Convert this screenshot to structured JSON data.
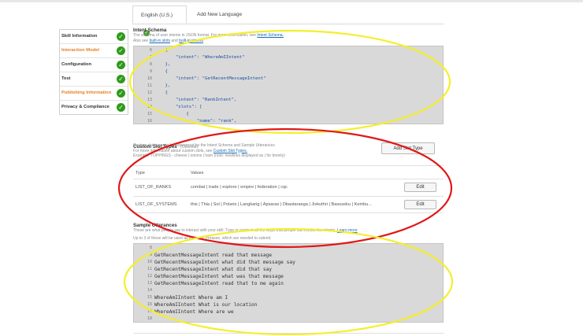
{
  "tabs": [
    {
      "label": "English (U.S.)",
      "active": true
    },
    {
      "label": "Add New Language",
      "active": false
    }
  ],
  "nav": [
    {
      "label": "Skill Information",
      "color": "#333333",
      "complete": true
    },
    {
      "label": "Interaction Model",
      "color": "#e67e22",
      "complete": true
    },
    {
      "label": "Configuration",
      "color": "#333333",
      "complete": true
    },
    {
      "label": "Test",
      "color": "#333333",
      "complete": true
    },
    {
      "label": "Publishing Information",
      "color": "#e67e22",
      "complete": true
    },
    {
      "label": "Privacy & Compliance",
      "color": "#333333",
      "complete": true
    }
  ],
  "intent_schema": {
    "title": "Intent Schema",
    "desc1_pre": "The schema of user intents in JSON format. For more information, see ",
    "desc1_link": "Intent Schema.",
    "desc2_pre": "Also see ",
    "desc2_link1": "built-in slots",
    "desc2_mid": " and ",
    "desc2_link2": "built-in intents",
    "desc2_post": ".",
    "lines": [
      {
        "n": "6",
        "t": "    {"
      },
      {
        "n": "7",
        "t": "        \"intent\": \"WhereAmIIntent\""
      },
      {
        "n": "8",
        "t": "    },"
      },
      {
        "n": "9",
        "t": "    {"
      },
      {
        "n": "10",
        "t": "        \"intent\": \"GetRecentMessageIntent\""
      },
      {
        "n": "11",
        "t": "    },"
      },
      {
        "n": "12",
        "t": "    {"
      },
      {
        "n": "13",
        "t": "        \"intent\": \"RankIntent\","
      },
      {
        "n": "14",
        "t": "        \"slots\": ["
      },
      {
        "n": "15",
        "t": "            {"
      },
      {
        "n": "16",
        "t": "                \"name\": \"rank\","
      }
    ]
  },
  "custom_slot_types": {
    "title": "Custom Slot Types",
    "optional": "(Optional)",
    "desc1": "Custom slot types to be referenced by the Intent Schema and Sample Utterances",
    "desc2_pre": "For more information about custom slots, see ",
    "desc2_link": "Custom Slot Types.",
    "desc3": "Example: TOPPINGS - cheese | onions | ham (note: newlines displayed as | for brevity)",
    "add_button": "Add Slot Type",
    "col_type": "Type",
    "col_values": "Values",
    "rows": [
      {
        "type": "LIST_OF_RANKS",
        "values": "combat | trade | explore | empire | federation | cqc",
        "edit": "Edit"
      },
      {
        "type": "LIST_OF_SYSTEMS",
        "values": "this | Thia | Sol | Polaris | Langkarig | Apsaras | Dbastaraega | Jivkuthri | Basuseku | Kembu...",
        "edit": "Edit"
      }
    ]
  },
  "sample_utterances": {
    "title": "Sample Utterances",
    "desc1_pre": "These are what people say to interact with your skill. Type or paste in all the ways that people can invoke the intents. ",
    "desc1_link": "Learn more",
    "desc2": "Up to 3 of these will be used as Example Phrases, which are needed to submit.",
    "lines": [
      {
        "n": "8",
        "t": ""
      },
      {
        "n": "9",
        "t": "GetRecentMessageIntent read that message"
      },
      {
        "n": "10",
        "t": "GetRecentMessageIntent what did that message say"
      },
      {
        "n": "11",
        "t": "GetRecentMessageIntent what did that say"
      },
      {
        "n": "12",
        "t": "GetRecentMessageIntent what was that message"
      },
      {
        "n": "13",
        "t": "GetRecentMessageIntent read that to me again"
      },
      {
        "n": "14",
        "t": ""
      },
      {
        "n": "15",
        "t": "WhereAmIIntent Where am I"
      },
      {
        "n": "16",
        "t": "WhereAmIIntent What is our location"
      },
      {
        "n": "17",
        "t": "WhereAmIIntent Where are we"
      },
      {
        "n": "18",
        "t": ""
      }
    ]
  },
  "colors": {
    "check_green": "#2e9a1b",
    "nav_orange": "#e67e22",
    "annotation_yellow": "#f5ee2a",
    "annotation_red": "#e01818",
    "code_bg": "#d9d9d9",
    "json_blue": "#1c4fa0",
    "link_blue": "#1a6ab3"
  }
}
